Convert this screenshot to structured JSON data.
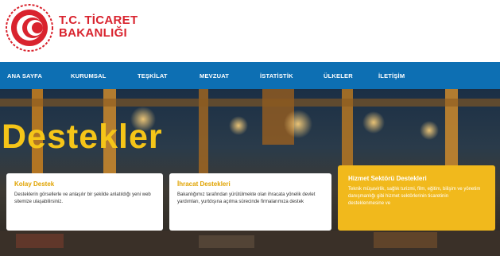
{
  "logo": {
    "line1": "T.C. TİCARET",
    "line2": "BAKANLIĞI"
  },
  "nav": [
    "ANA SAYFA",
    "KURUMSAL",
    "TEŞKİLAT",
    "MEVZUAT",
    "İSTATİSTİK",
    "ÜLKELER",
    "İLETİŞİM"
  ],
  "hero": {
    "title": "Destekler"
  },
  "cards": [
    {
      "title": "Kolay Destek",
      "text": "Desteklerin görsellerle ve anlaşılır bir şekilde anlatıldığı yeni web sitemize ulaşabilirsiniz."
    },
    {
      "title": "İhracat Destekleri",
      "text": "Bakanlığımız tarafından yürütülmekte olan ihracata yönelik devlet yardımları, yurtdışına açılma sürecinde firmalarımıza destek"
    },
    {
      "title": "Hizmet Sektörü Destekleri",
      "text": "Teknik müşavirlik, sağlık turizmi, film, eğitim, bilişim ve yönetim danışmanlığı gibi hizmet sektörlerinin ticaretinin desteklenmesine ve"
    }
  ],
  "colors": {
    "brand_red": "#d9232e",
    "nav_blue": "#0d6fb3",
    "accent_yellow": "#f5c518",
    "card_yellow": "#f1b91c"
  }
}
